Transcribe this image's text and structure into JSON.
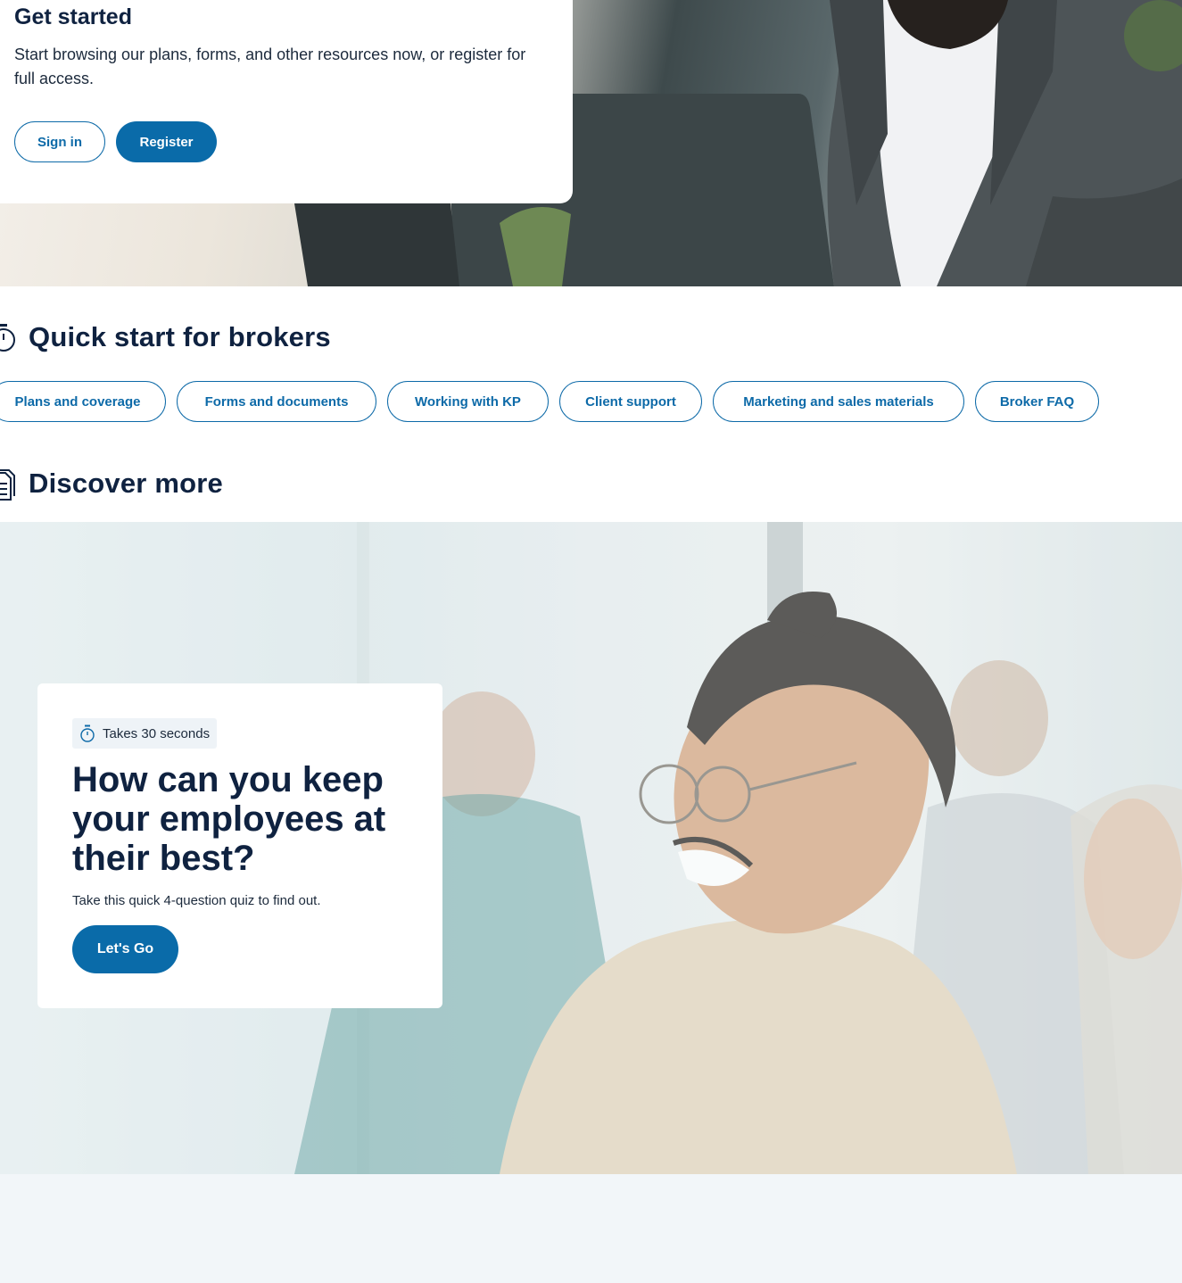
{
  "hero": {
    "title": "Get started",
    "description": "Start browsing our plans, forms, and other resources now, or register for full access.",
    "sign_in_label": "Sign in",
    "register_label": "Register"
  },
  "quick_start": {
    "title": "Quick start for brokers",
    "icon": "stopwatch-icon",
    "links": [
      {
        "label": "Plans and coverage"
      },
      {
        "label": "Forms and documents"
      },
      {
        "label": "Working with KP"
      },
      {
        "label": "Client support"
      },
      {
        "label": "Marketing and sales materials"
      },
      {
        "label": "Broker FAQ"
      }
    ]
  },
  "discover": {
    "title": "Discover more",
    "icon": "document-icon"
  },
  "quiz": {
    "badge": "Takes 30 seconds",
    "badge_icon": "stopwatch-icon",
    "title": "How can you keep your employees at their best?",
    "description": "Take this quick 4-question quiz to find out.",
    "cta_label": "Let's Go"
  },
  "colors": {
    "brand_blue": "#0a6ba9",
    "heading_navy": "#0f2240"
  }
}
